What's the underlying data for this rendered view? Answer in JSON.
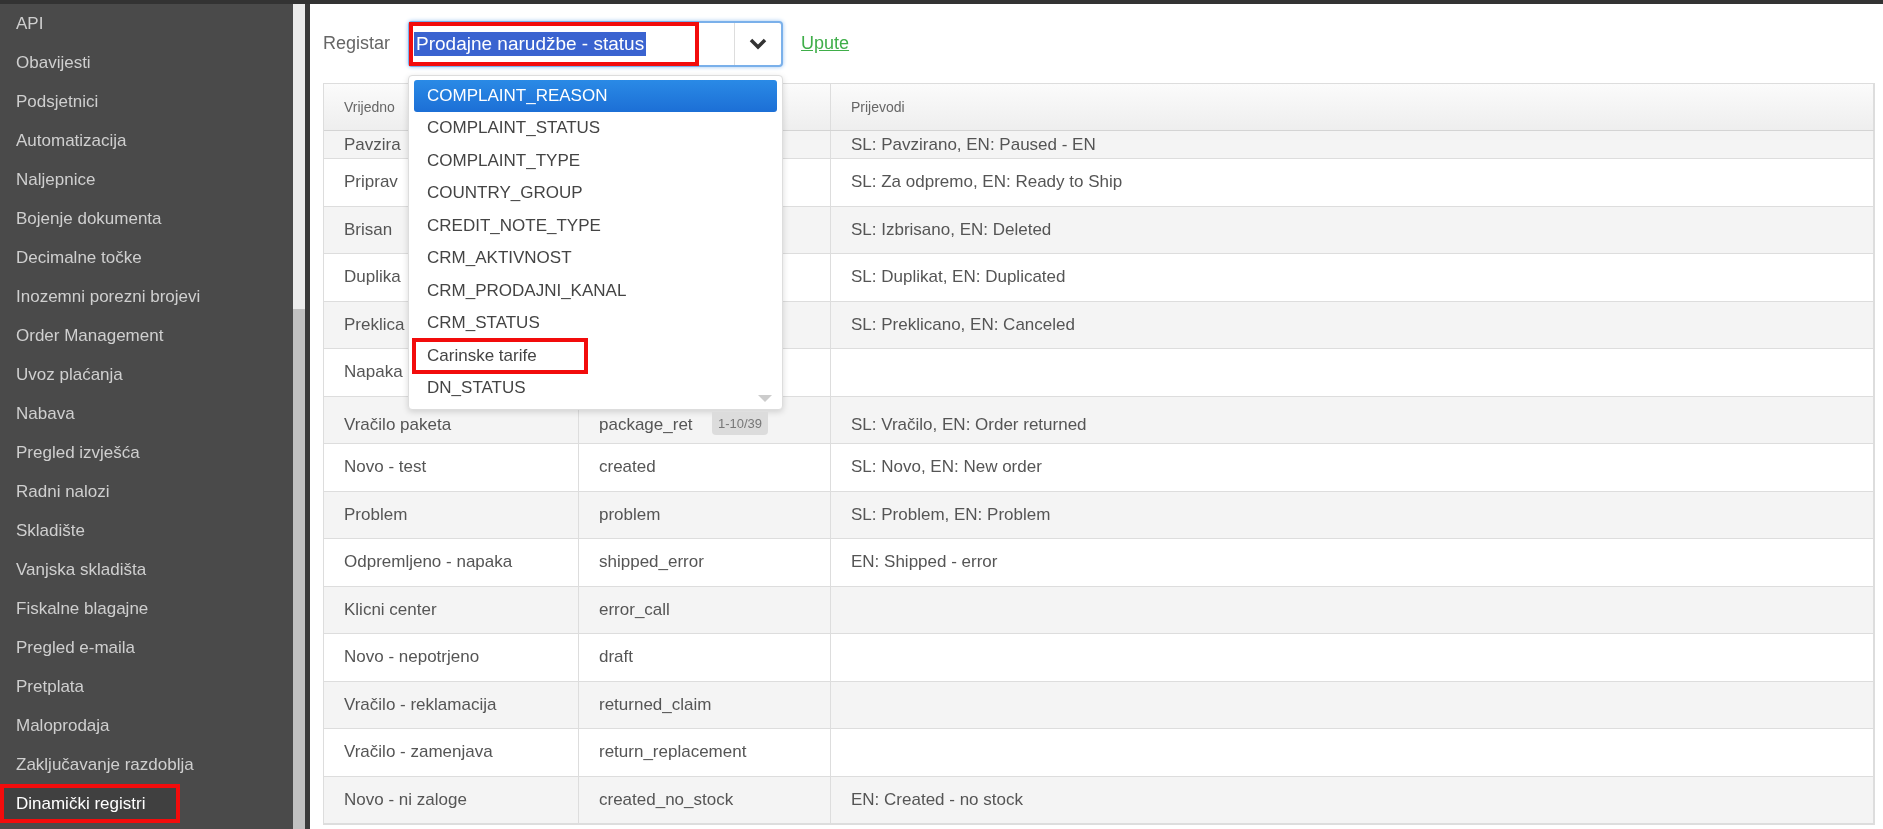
{
  "sidebar": {
    "items": [
      {
        "label": "API",
        "selected": false,
        "highlighted": false
      },
      {
        "label": "Obavijesti",
        "selected": false,
        "highlighted": false
      },
      {
        "label": "Podsjetnici",
        "selected": false,
        "highlighted": false
      },
      {
        "label": "Automatizacija",
        "selected": false,
        "highlighted": false
      },
      {
        "label": "Naljepnice",
        "selected": false,
        "highlighted": false
      },
      {
        "label": "Bojenje dokumenta",
        "selected": false,
        "highlighted": false
      },
      {
        "label": "Decimalne točke",
        "selected": false,
        "highlighted": false
      },
      {
        "label": "Inozemni porezni brojevi",
        "selected": false,
        "highlighted": false
      },
      {
        "label": "Order Management",
        "selected": false,
        "highlighted": false
      },
      {
        "label": "Uvoz plaćanja",
        "selected": false,
        "highlighted": false
      },
      {
        "label": "Nabava",
        "selected": false,
        "highlighted": false
      },
      {
        "label": "Pregled izvješća",
        "selected": false,
        "highlighted": false
      },
      {
        "label": "Radni nalozi",
        "selected": false,
        "highlighted": false
      },
      {
        "label": "Skladište",
        "selected": false,
        "highlighted": false
      },
      {
        "label": "Vanjska skladišta",
        "selected": false,
        "highlighted": false
      },
      {
        "label": "Fiskalne blagajne",
        "selected": false,
        "highlighted": false
      },
      {
        "label": "Pregled e-maila",
        "selected": false,
        "highlighted": false
      },
      {
        "label": "Pretplata",
        "selected": false,
        "highlighted": false
      },
      {
        "label": "Maloprodaja",
        "selected": false,
        "highlighted": false
      },
      {
        "label": "Zaključavanje razdoblja",
        "selected": false,
        "highlighted": false
      },
      {
        "label": "Dinamički registri",
        "selected": true,
        "highlighted": true
      }
    ]
  },
  "register": {
    "label": "Registar",
    "value": "Prodajne narudžbe - status",
    "highlighted": true,
    "expanded": true,
    "link": "Upute",
    "options": [
      {
        "label": "COMPLAINT_REASON",
        "selected": true,
        "highlighted": false
      },
      {
        "label": "COMPLAINT_STATUS",
        "selected": false,
        "highlighted": false
      },
      {
        "label": "COMPLAINT_TYPE",
        "selected": false,
        "highlighted": false
      },
      {
        "label": "COUNTRY_GROUP",
        "selected": false,
        "highlighted": false
      },
      {
        "label": "CREDIT_NOTE_TYPE",
        "selected": false,
        "highlighted": false
      },
      {
        "label": "CRM_AKTIVNOST",
        "selected": false,
        "highlighted": false
      },
      {
        "label": "CRM_PRODAJNI_KANAL",
        "selected": false,
        "highlighted": false
      },
      {
        "label": "CRM_STATUS",
        "selected": false,
        "highlighted": false
      },
      {
        "label": "Carinske tarife",
        "selected": false,
        "highlighted": true
      },
      {
        "label": "DN_STATUS",
        "selected": false,
        "highlighted": false
      }
    ],
    "pager": "1-10/39"
  },
  "table": {
    "columns": {
      "column_1": "Vrijedno",
      "column_3": "Prijevodi"
    },
    "rows": [
      {
        "column_1": "Pavzira",
        "column_3": "SL: Pavzirano, EN: Paused - EN"
      },
      {
        "column_1": "Priprav",
        "column_3": "SL: Za odpremo, EN: Ready to Ship"
      },
      {
        "column_1": "Brisan",
        "column_3": "SL: Izbrisano, EN: Deleted"
      },
      {
        "column_1": "Duplika",
        "column_3": "SL: Duplikat, EN: Duplicated"
      },
      {
        "column_1": "Preklica",
        "column_3": "SL: Preklicano, EN: Canceled"
      },
      {
        "column_1": "Napaka"
      },
      {
        "column_1": "Vračilo paketa",
        "column_2": "package_ret",
        "column_3": "SL: Vračilo, EN: Order returned"
      },
      {
        "column_1": "Novo - test",
        "column_2": "created",
        "column_3": "SL: Novo, EN: New order"
      },
      {
        "column_1": "Problem",
        "column_2": "problem",
        "column_3": "SL: Problem, EN: Problem"
      },
      {
        "column_1": "Odpremljeno - napaka",
        "column_2": "shipped_error",
        "column_3": "EN: Shipped - error"
      },
      {
        "column_1": "Klicni center",
        "column_2": "error_call"
      },
      {
        "column_1": "Novo - nepotrjeno",
        "column_2": "draft"
      },
      {
        "column_1": "Vračilo - reklamacija",
        "column_2": "returned_claim"
      },
      {
        "column_1": "Vračilo - zamenjava",
        "column_2": "return_replacement"
      },
      {
        "column_1": "Novo - ni zaloge",
        "column_2": "created_no_stock",
        "column_3": "EN: Created - no stock"
      }
    ]
  }
}
